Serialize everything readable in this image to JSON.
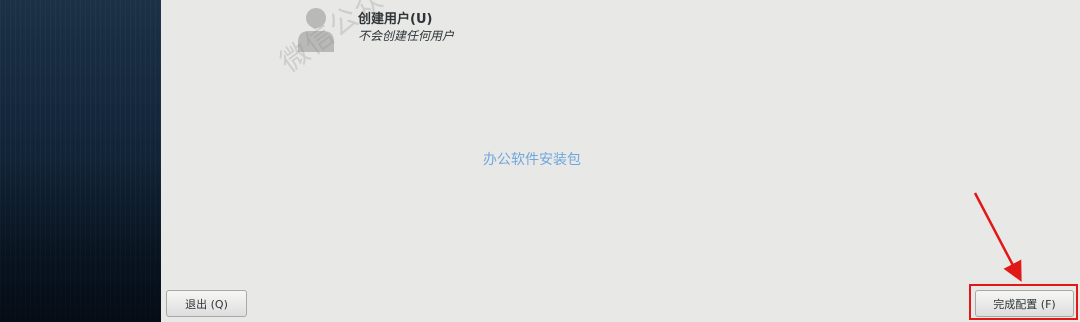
{
  "spoke": {
    "title": "创建用户(U)",
    "status": "不会创建任何用户"
  },
  "watermark": "微信公众号:",
  "center_note": "办公软件安装包",
  "buttons": {
    "quit_label": "退出 (Q)",
    "finish_label": "完成配置 (F)"
  },
  "icons": {
    "user": "user-icon",
    "arrow": "arrow-icon"
  },
  "colors": {
    "sidebar": "#13263a",
    "background": "#e8e8e7",
    "highlight": "#e01818",
    "note_text": "#6fa8dc"
  }
}
